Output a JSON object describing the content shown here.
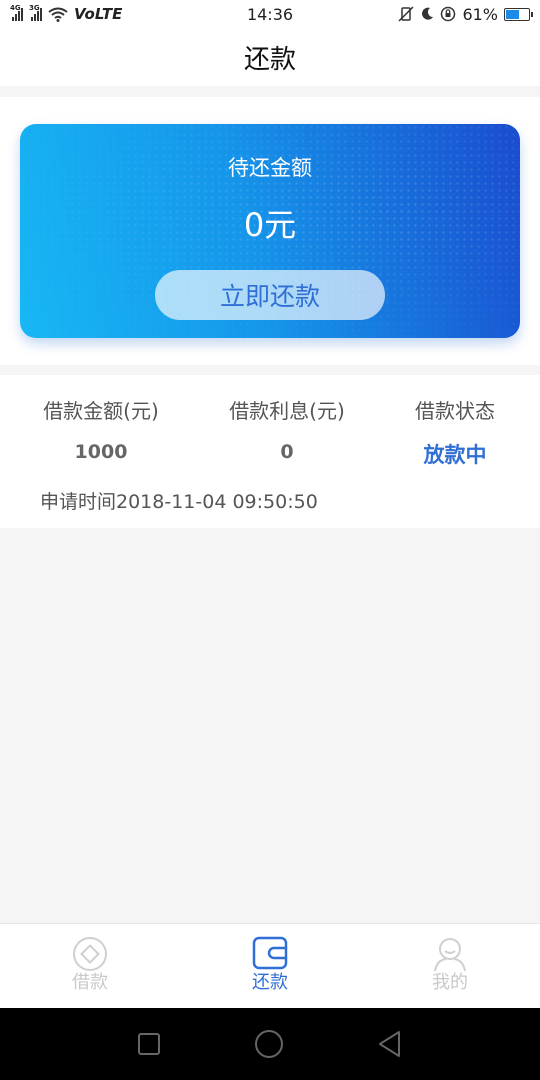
{
  "status_bar": {
    "sim1_label": "4G",
    "sim2_label": "3G",
    "network_label": "VoLTE",
    "time": "14:36",
    "battery_text": "61%",
    "battery_level": 0.61
  },
  "header": {
    "title": "还款"
  },
  "card": {
    "label": "待还金额",
    "amount": "0元",
    "button_label": "立即还款",
    "colors": {
      "start": "#17b7f4",
      "end": "#1a4ccf"
    }
  },
  "loan": {
    "columns": [
      {
        "header": "借款金额(元)",
        "value": "1000"
      },
      {
        "header": "借款利息(元)",
        "value": "0"
      },
      {
        "header": "借款状态",
        "value": "放款中"
      }
    ],
    "apply_time": "申请时间2018-11-04 09:50:50",
    "status_color": "#2f6fd6"
  },
  "tabs": [
    {
      "label": "借款",
      "icon": "diamond-circle-icon",
      "active": false
    },
    {
      "label": "还款",
      "icon": "wallet-icon",
      "active": true
    },
    {
      "label": "我的",
      "icon": "person-icon",
      "active": false
    }
  ],
  "system_nav": {
    "recent_icon": "square-icon",
    "home_icon": "circle-icon",
    "back_icon": "triangle-back-icon"
  }
}
